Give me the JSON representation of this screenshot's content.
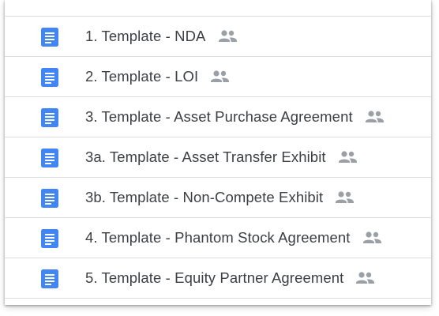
{
  "files": [
    {
      "name": "1. Template - NDA",
      "type_icon": "google-docs-icon",
      "shared_icon": "shared-people-icon"
    },
    {
      "name": "2. Template - LOI",
      "type_icon": "google-docs-icon",
      "shared_icon": "shared-people-icon"
    },
    {
      "name": "3. Template - Asset Purchase Agreement",
      "type_icon": "google-docs-icon",
      "shared_icon": "shared-people-icon"
    },
    {
      "name": "3a. Template - Asset Transfer Exhibit",
      "type_icon": "google-docs-icon",
      "shared_icon": "shared-people-icon"
    },
    {
      "name": "3b. Template - Non-Compete Exhibit",
      "type_icon": "google-docs-icon",
      "shared_icon": "shared-people-icon"
    },
    {
      "name": "4. Template - Phantom Stock Agreement",
      "type_icon": "google-docs-icon",
      "shared_icon": "shared-people-icon"
    },
    {
      "name": "5. Template - Equity Partner Agreement",
      "type_icon": "google-docs-icon",
      "shared_icon": "shared-people-icon"
    }
  ],
  "colors": {
    "doc_icon_blue": "#4285f4",
    "text": "#3c4043",
    "shared_icon_gray": "#9aa0a6",
    "divider": "#dadce0"
  }
}
